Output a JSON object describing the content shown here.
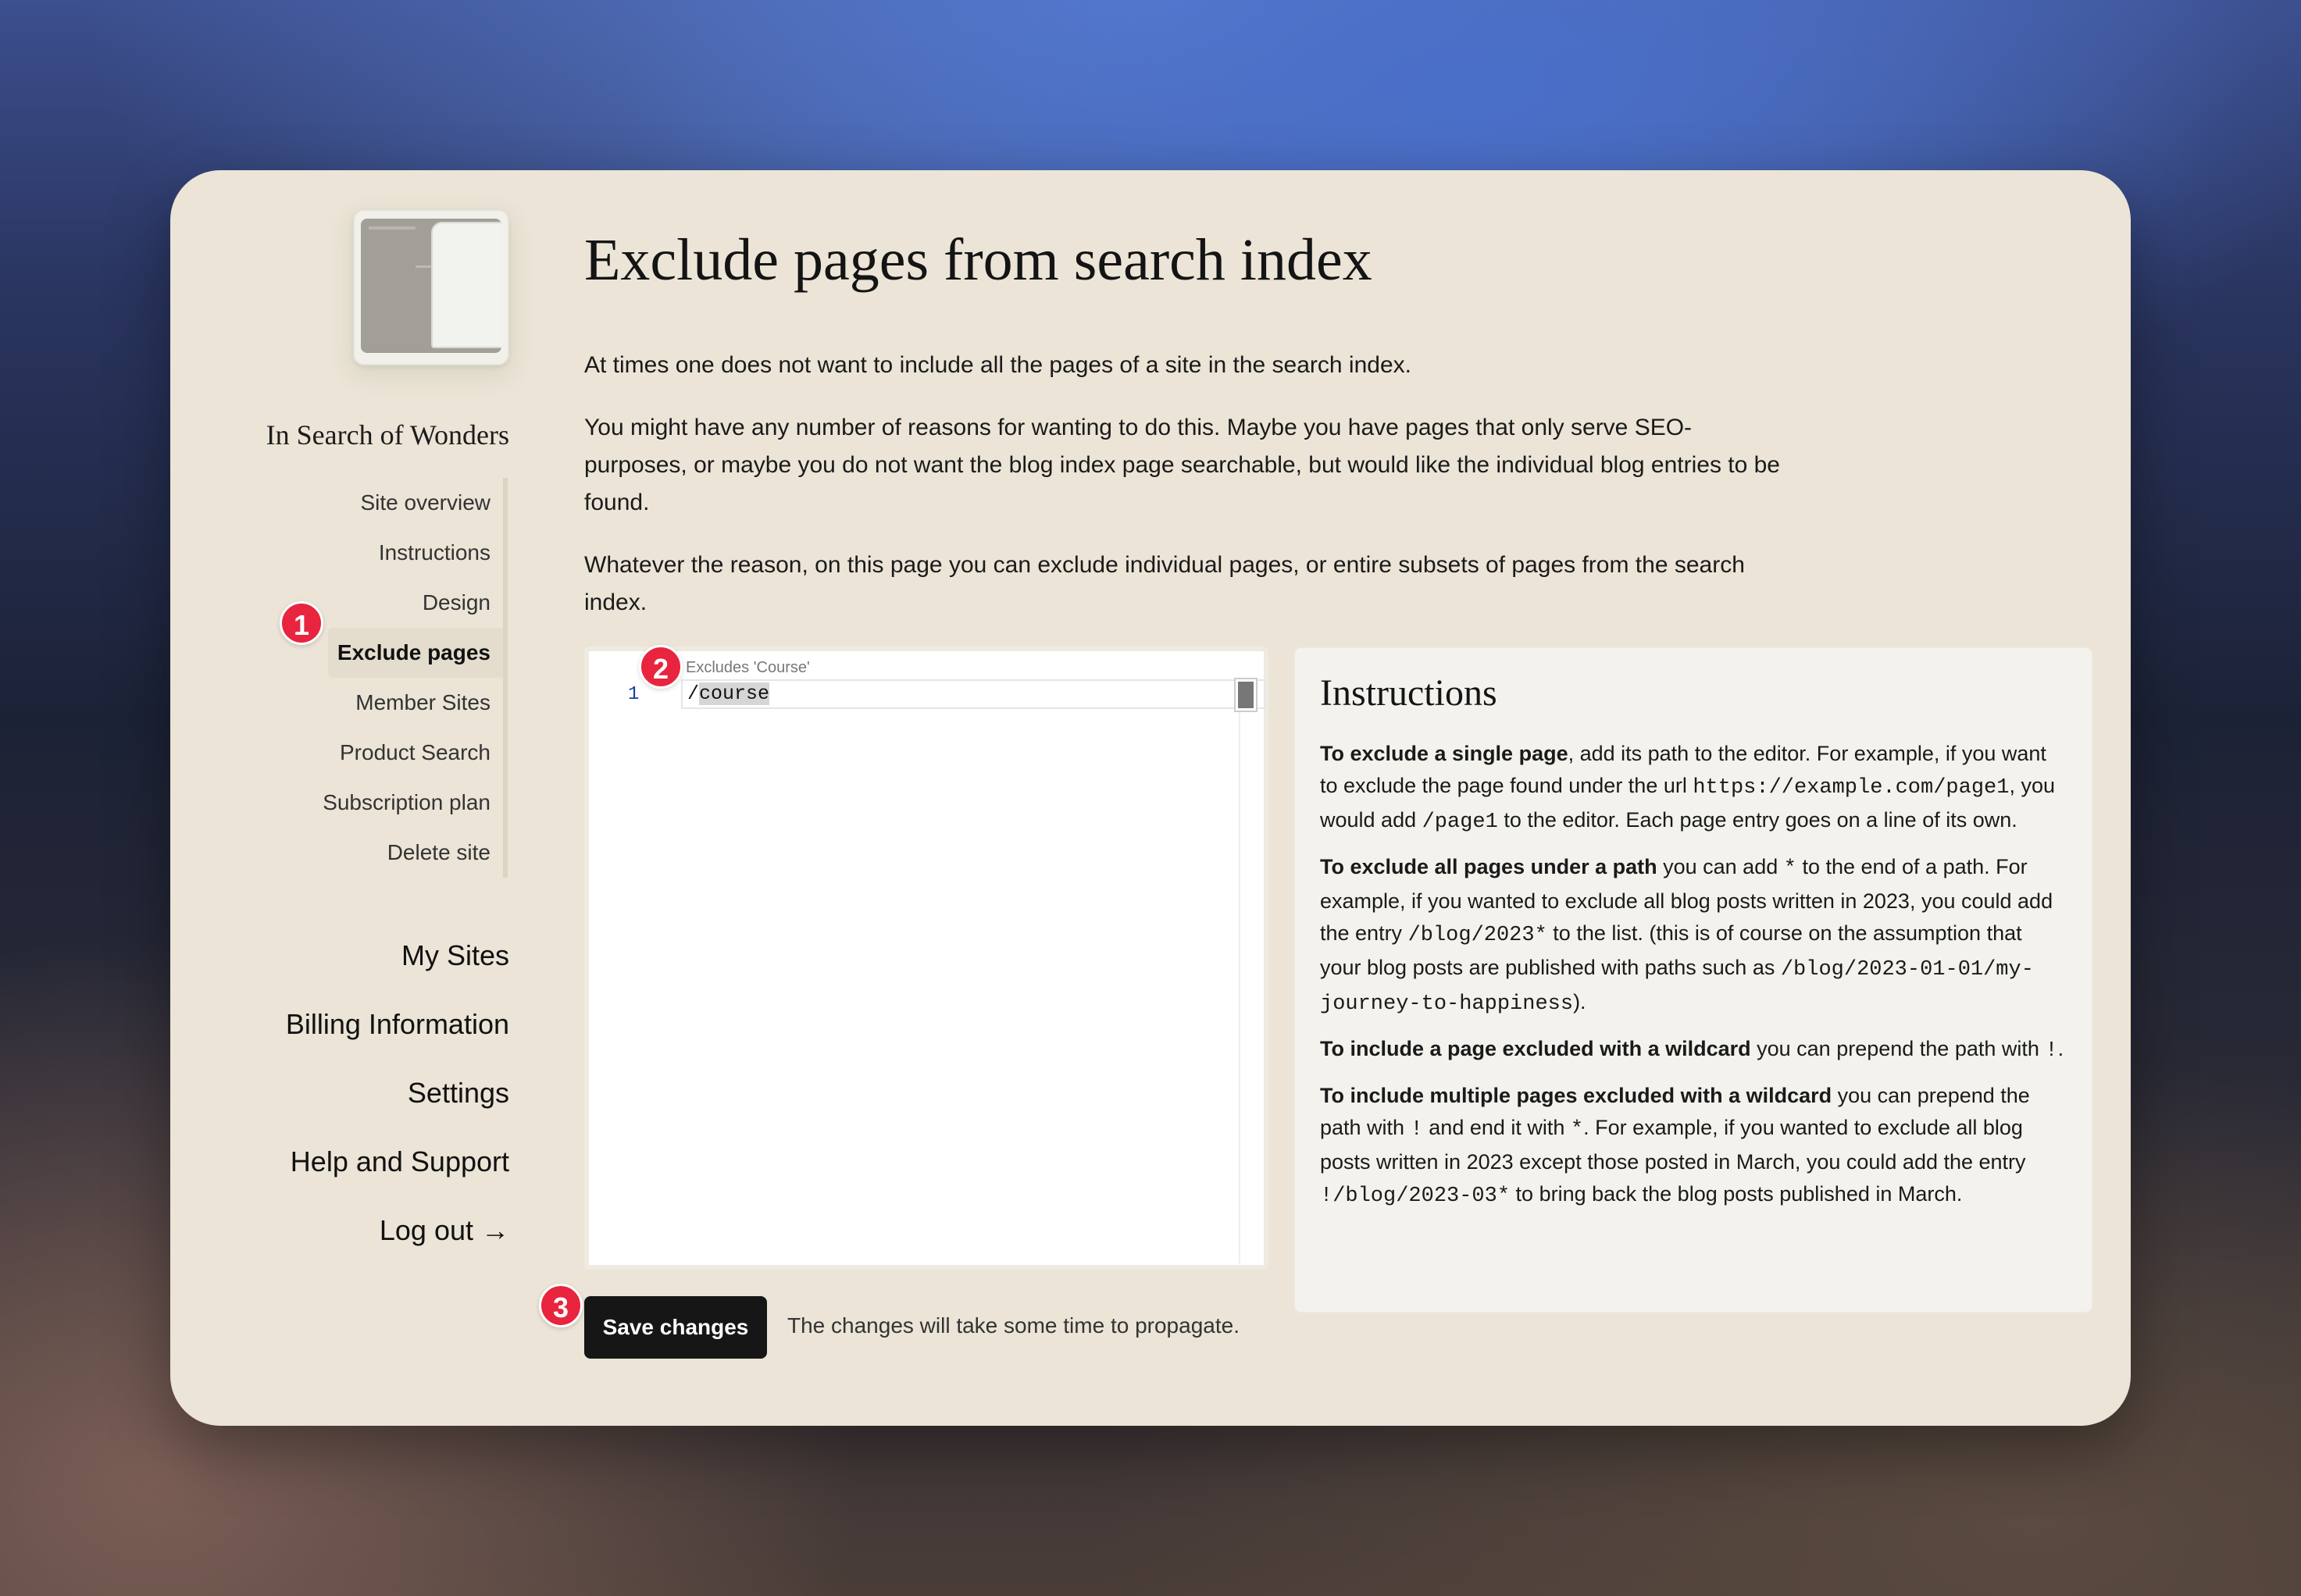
{
  "site": {
    "name": "In Search of Wonders"
  },
  "subnav": [
    {
      "label": "Site overview"
    },
    {
      "label": "Instructions"
    },
    {
      "label": "Design"
    },
    {
      "label": "Exclude pages",
      "active": true
    },
    {
      "label": "Member Sites"
    },
    {
      "label": "Product Search"
    },
    {
      "label": "Subscription plan"
    },
    {
      "label": "Delete site"
    }
  ],
  "mainnav": [
    {
      "label": "My Sites"
    },
    {
      "label": "Billing Information"
    },
    {
      "label": "Settings"
    },
    {
      "label": "Help and Support"
    },
    {
      "label": "Log out →"
    }
  ],
  "badges": [
    "1",
    "2",
    "3"
  ],
  "page": {
    "title": "Exclude pages from search index",
    "intro": [
      "At times one does not want to include all the pages of a site in the search index.",
      "You might have any number of reasons for wanting to do this. Maybe you have pages that only serve SEO-purposes, or maybe you do not want the blog index page searchable, but would like the individual blog entries to be found.",
      "Whatever the reason, on this page you can exclude individual pages, or entire subsets of pages from the search index."
    ]
  },
  "editor": {
    "hint": "Excludes 'Course'",
    "line_number": "1",
    "line_prefix": "/",
    "line_selected": "course"
  },
  "actions": {
    "save_label": "Save changes",
    "note": "The changes will take some time to propagate."
  },
  "instructions": {
    "title": "Instructions",
    "p1_bold": "To exclude a single page",
    "p1_a": ", add its path to the editor. For example, if you want to exclude the page found under the url ",
    "p1_code1": "https://example.com/page1",
    "p1_b": ", you would add ",
    "p1_code2": "/page1",
    "p1_c": " to the editor. Each page entry goes on a line of its own.",
    "p2_bold": "To exclude all pages under a path",
    "p2_a": " you can add ",
    "p2_code1": "*",
    "p2_b": " to the end of a path. For example, if you wanted to exclude all blog posts written in 2023, you could add the entry ",
    "p2_code2": "/blog/2023*",
    "p2_c": " to the list. (this is of course on the assumption that your blog posts are published with paths such as ",
    "p2_code3": "/blog/2023-01-01/my-journey-to-happiness",
    "p2_d": ").",
    "p3_bold": "To include a page excluded with a wildcard",
    "p3_a": " you can prepend the path with ",
    "p3_code1": "!",
    "p3_b": ".",
    "p4_bold": "To include multiple pages excluded with a wildcard",
    "p4_a": " you can prepend the path with ",
    "p4_code1": "!",
    "p4_b": " and end it with ",
    "p4_code2": "*",
    "p4_c": ". For example, if you wanted to exclude all blog posts written in 2023 except those posted in March, you could add the entry ",
    "p4_code3": "!/blog/2023-03*",
    "p4_d": " to bring back the blog posts published in March."
  },
  "colors": {
    "window_bg": "#ebe4d7",
    "badge": "#e8243f",
    "button": "#161616",
    "panel": "#f3f2ed"
  }
}
